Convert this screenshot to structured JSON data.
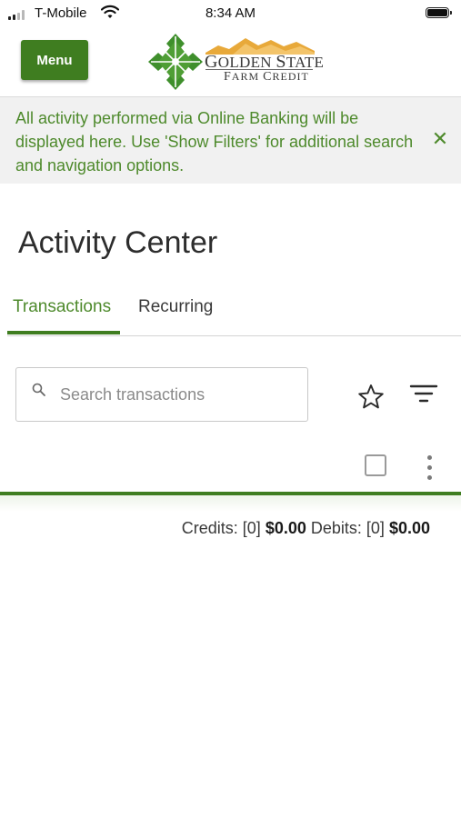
{
  "status_bar": {
    "carrier": "T-Mobile",
    "time": "8:34 AM",
    "icons": [
      "signal-icon",
      "wifi-icon",
      "battery-icon"
    ]
  },
  "header": {
    "menu_label": "Menu",
    "logo": {
      "line1_cap": "G",
      "line1_rest": "OLDEN ",
      "line1_cap2": "S",
      "line1_rest2": "TATE",
      "line2_cap": "F",
      "line2_rest": "ARM ",
      "line2_cap2": "C",
      "line2_rest2": "REDIT"
    }
  },
  "banner": {
    "text": "All activity performed via Online Banking will be displayed here. Use 'Show Filters' for additional search and navigation options.",
    "close_glyph": "✕"
  },
  "page": {
    "title": "Activity Center"
  },
  "tabs": [
    {
      "label": "Transactions",
      "active": true
    },
    {
      "label": "Recurring",
      "active": false
    }
  ],
  "search": {
    "placeholder": "Search transactions",
    "value": ""
  },
  "toolbar_icons": [
    "star-icon",
    "filter-icon",
    "checkbox",
    "more-vertical-icon"
  ],
  "totals": {
    "credits_label": "Credits:",
    "credits_count": "[0]",
    "credits_amount": "$0.00",
    "debits_label": "Debits:",
    "debits_count": "[0]",
    "debits_amount": "$0.00"
  },
  "colors": {
    "brand_green": "#3f7d20",
    "text_green": "#4e8a2c",
    "banner_bg": "#f1f1f1",
    "logo_gold": "#e8a93a"
  }
}
